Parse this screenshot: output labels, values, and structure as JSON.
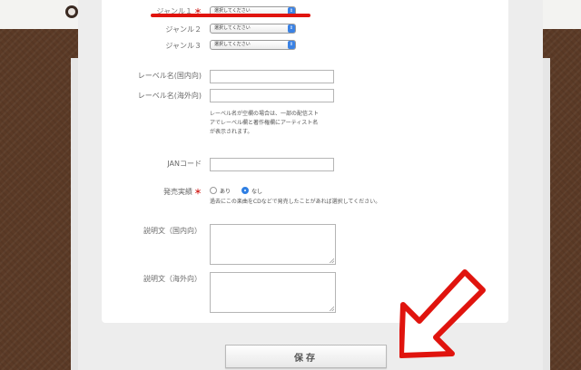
{
  "form": {
    "genre1": {
      "label": "ジャンル１",
      "required_mark": "＊",
      "value": "選択してください"
    },
    "genre2": {
      "label": "ジャンル２",
      "value": "選択してください"
    },
    "genre3": {
      "label": "ジャンル３",
      "value": "選択してください"
    },
    "label_domestic": {
      "label": "レーベル名(国内向)",
      "value": ""
    },
    "label_overseas": {
      "label": "レーベル名(海外向)",
      "value": ""
    },
    "label_note": [
      "レーベル名が空欄の場合は、一部の配信スト",
      "アでレーベル欄と著作権欄にアーティスト名",
      "が表示されます。"
    ],
    "jan": {
      "label": "JANコード",
      "value": ""
    },
    "release": {
      "label": "発売実績",
      "required_mark": "＊",
      "options": [
        "あり",
        "なし"
      ],
      "selected": "なし",
      "note": "過去にこの楽曲をCDなどで発売したことがあれば選択してください。"
    },
    "desc_domestic": {
      "label": "説明文（国内向）",
      "value": ""
    },
    "desc_overseas": {
      "label": "説明文（海外向）",
      "value": ""
    },
    "save_label": "保存"
  },
  "colors": {
    "required": "#d3201c",
    "annotation": "#e0140e",
    "accent": "#2f7fe3"
  },
  "annotations": {
    "arrow": "red-arrow-pointing-to-save",
    "underline": "red-underline-genre1"
  }
}
